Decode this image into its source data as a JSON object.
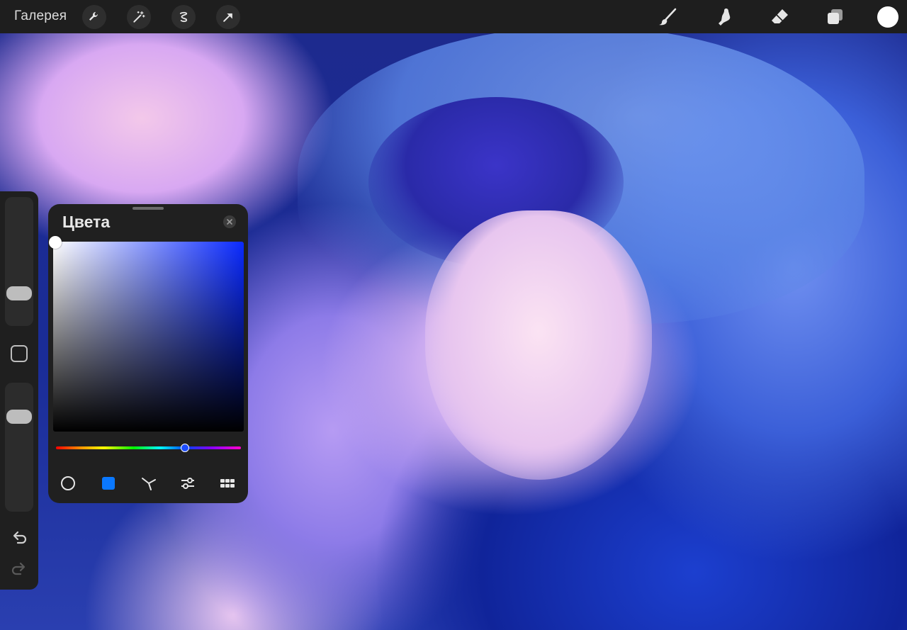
{
  "topbar": {
    "gallery_label": "Галерея",
    "left_tools": [
      "wrench-icon",
      "magic-wand-icon",
      "selection-icon",
      "transform-arrow-icon"
    ],
    "right_tools": [
      "brush-icon",
      "smudge-icon",
      "eraser-icon",
      "layers-icon"
    ],
    "current_color": "#ffffff"
  },
  "sidebar": {
    "controls": [
      "brush-size-slider",
      "modify-square-button",
      "opacity-slider",
      "undo-icon",
      "redo-icon"
    ]
  },
  "colors_panel": {
    "title": "Цвета",
    "selected_color": "#ffffff",
    "hue_color": "#0a2aff",
    "modes": [
      "disc-icon",
      "classic-square-icon",
      "harmony-icon",
      "value-sliders-icon",
      "palettes-grid-icon"
    ],
    "active_mode": "classic-square-icon"
  },
  "colors": {
    "topbar_bg": "#1e1e1e",
    "panel_bg": "#202020",
    "accent_blue": "#0a78ff"
  }
}
